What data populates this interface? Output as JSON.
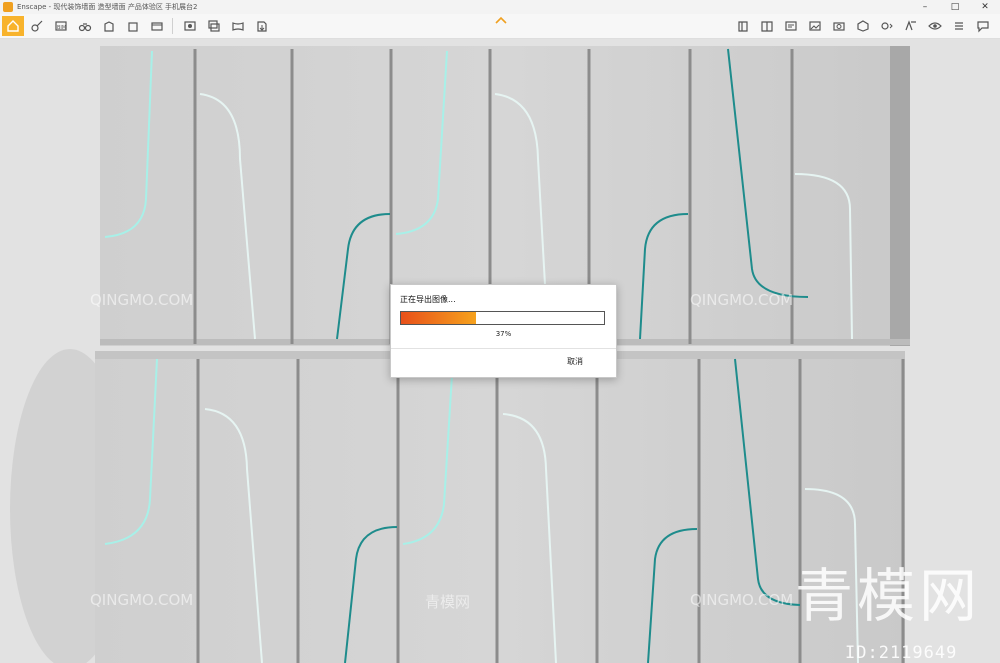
{
  "window": {
    "title": "Enscape - 现代装饰墙面 造型墙面 产品体验区 手机展台2",
    "controls": [
      "–",
      "□",
      "✕"
    ]
  },
  "toolbar": {
    "left_icons": [
      "home-icon",
      "orbit-icon",
      "bim-icon",
      "binoculars-icon",
      "building-icon",
      "box-icon",
      "film-icon",
      "screenshot-icon",
      "batch-render-icon",
      "panorama-icon",
      "export-icon"
    ],
    "right_icons": [
      "asset-library-icon",
      "book-icon",
      "settings-icon",
      "image-icon",
      "camera-icon",
      "cube-icon",
      "materials-icon",
      "views-icon",
      "eye-icon",
      "visual-settings-icon",
      "feedback-icon"
    ],
    "active": "home-icon"
  },
  "dialog": {
    "title": "正在导出图像...",
    "progress": 0.37,
    "progress_text": "37%",
    "cancel_label": "取消"
  },
  "watermarks": {
    "site": "QINGMO.COM",
    "site_cn": "青模网",
    "brand_big": "青模网",
    "id_text": "ID:2119649"
  },
  "colors": {
    "accent": "#f8b32c",
    "progress_start": "#e8501a",
    "progress_end": "#f6a21d",
    "glow": "#a8f0e8"
  }
}
